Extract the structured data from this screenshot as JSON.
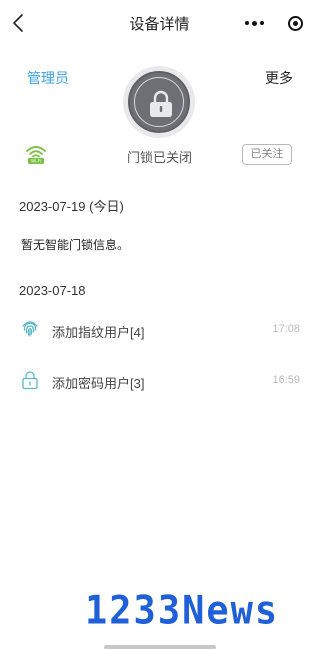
{
  "nav": {
    "title": "设备详情"
  },
  "header": {
    "admin_label": "管理员",
    "more_label": "更多"
  },
  "lock": {
    "status": "门锁已关闭",
    "follow_label": "已关注",
    "wifi_text": "Wi-Fi"
  },
  "day1": {
    "date": "2023-07-19 (今日)",
    "empty_message": "暂无智能门锁信息。"
  },
  "day2": {
    "date": "2023-07-18",
    "logs": [
      {
        "icon": "fingerprint-icon",
        "text": "添加指纹用户[4]",
        "time": "17:08"
      },
      {
        "icon": "password-lock-icon",
        "text": "添加密码用户[3]",
        "time": "16:59"
      }
    ]
  },
  "watermark": "1233News",
  "colors": {
    "accent": "#3aa3e8",
    "lock_gray": "#6e6f75",
    "wifi_green": "#7bc043",
    "watermark": "#1f5fd8"
  }
}
